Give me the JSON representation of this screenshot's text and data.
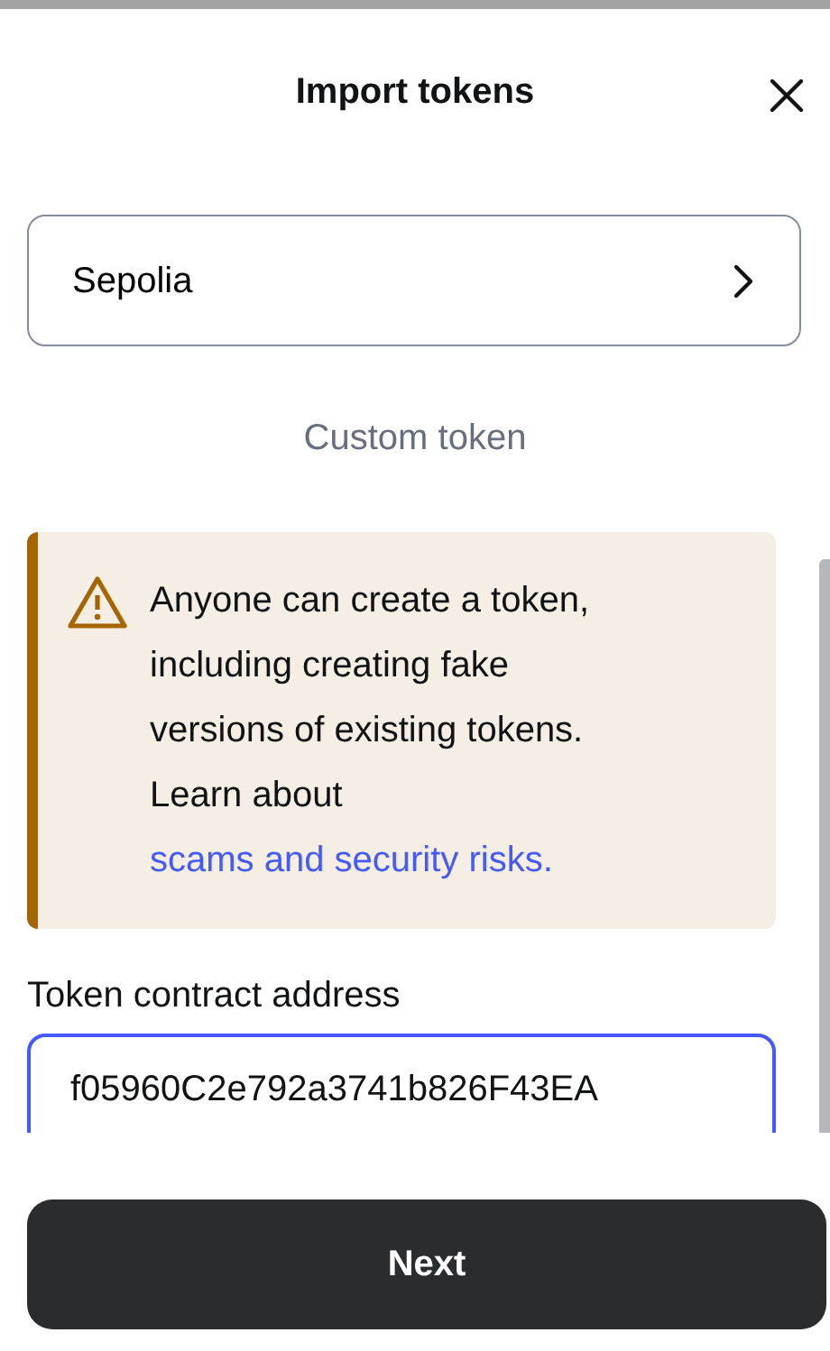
{
  "title": "Import tokens",
  "network": {
    "label": "Sepolia"
  },
  "section_label": "Custom token",
  "warning": {
    "text": "Anyone can create a token, including creating fake versions of existing tokens. Learn about",
    "link": "scams and security risks."
  },
  "address_field": {
    "label": "Token contract address",
    "value": "f05960C2e792a3741b826F43EA",
    "focused": true
  },
  "buttons": [
    {
      "label": "Next"
    }
  ]
}
